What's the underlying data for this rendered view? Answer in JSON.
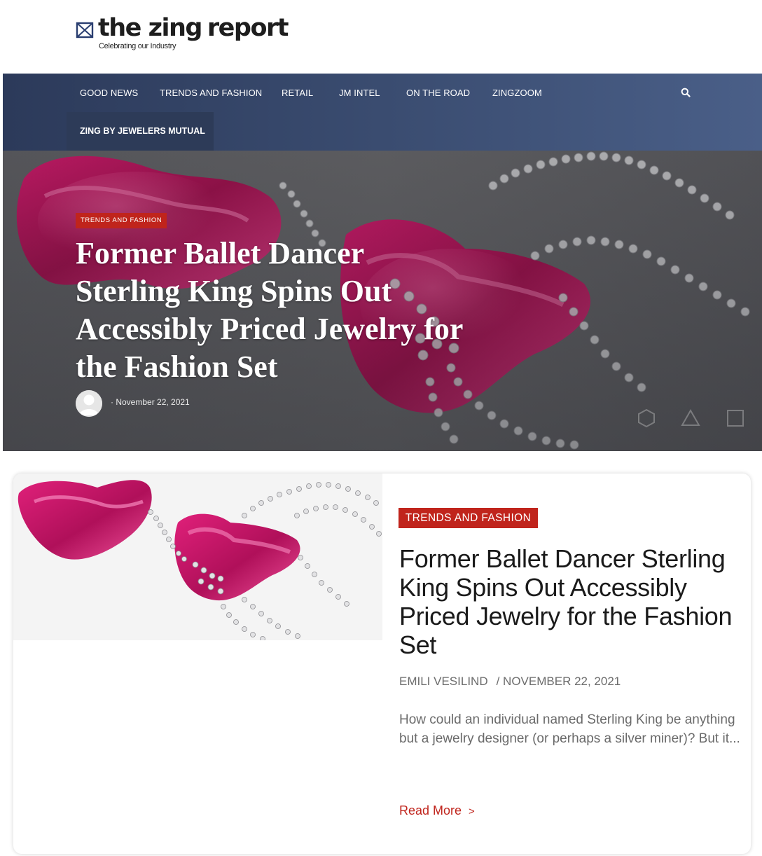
{
  "site": {
    "logo_text_1": "the zing",
    "logo_text_2": "report",
    "tagline": "Celebrating our Industry"
  },
  "nav": {
    "items": [
      {
        "label": "GOOD NEWS"
      },
      {
        "label": "TRENDS AND FASHION"
      },
      {
        "label": "RETAIL"
      },
      {
        "label": "JM INTEL"
      },
      {
        "label": "ON THE ROAD"
      },
      {
        "label": "ZINGZOOM"
      }
    ],
    "sub_item": "ZING BY JEWELERS MUTUAL",
    "search_icon": "search-icon"
  },
  "hero": {
    "category": "TRENDS AND FASHION",
    "title": "Former Ballet Dancer Sterling King Spins Out Accessibly Priced Jewelry for the Fashion Set",
    "date": "· November 22, 2021",
    "avatar_icon": "user-avatar-icon"
  },
  "card": {
    "category": "TRENDS AND FASHION",
    "title": "Former Ballet Dancer Sterling King Spins Out Accessibly Priced Jewelry for the Fashion Set",
    "author": "EMILI VESILIND",
    "date": "/ NOVEMBER 22, 2021",
    "excerpt": "How could an individual named Sterling King be anything but a jewelry designer (or perhaps a silver miner)? But it...",
    "read_more": "Read More",
    "read_more_arrow": ">"
  },
  "colors": {
    "accent_red": "#c0241c",
    "nav_blue": "#3a4c70",
    "jewelry_pink": "#d81b70"
  }
}
